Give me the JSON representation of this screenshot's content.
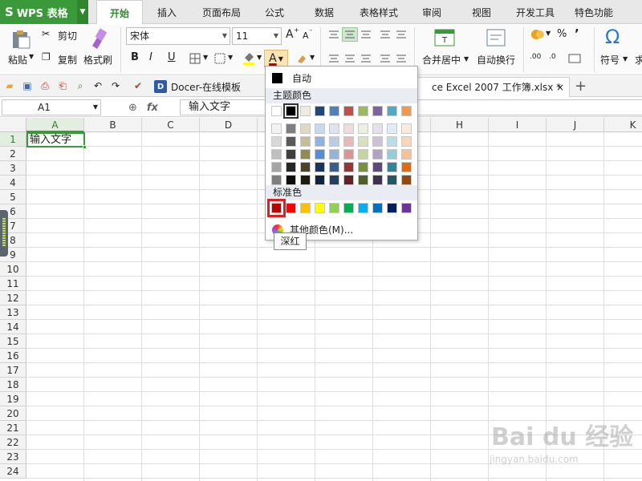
{
  "app": {
    "logo": "S",
    "name": "WPS 表格"
  },
  "menu": {
    "tabs": [
      "开始",
      "插入",
      "页面布局",
      "公式",
      "数据",
      "表格样式",
      "审阅",
      "视图",
      "开发工具",
      "特色功能"
    ],
    "active": 0
  },
  "ribbon": {
    "paste": "粘贴",
    "cut": "剪切",
    "copy": "复制",
    "format_painter": "格式刷",
    "font_name": "宋体",
    "font_size": "11",
    "bold": "B",
    "italic": "I",
    "underline": "U",
    "font_color_letter": "A",
    "merge_center": "合并居中",
    "wrap_text": "自动换行",
    "symbol": "符号",
    "percent": "%",
    "comma": "’",
    "inc_decimal": ".00",
    "dec_decimal": ".0",
    "bigA": "A",
    "smallA": "A",
    "partial_next": "求"
  },
  "quickbar": {
    "docer_tab": "Docer-在线模板",
    "file_tab": "ce Excel 2007 工作簿.xlsx *",
    "close": "×",
    "new_tab": "+"
  },
  "formula": {
    "cell_ref": "A1",
    "fx": "fx",
    "value": "输入文字"
  },
  "grid": {
    "columns": [
      "A",
      "B",
      "C",
      "D",
      "E",
      "F",
      "G",
      "H",
      "I",
      "J",
      "K"
    ],
    "rows": [
      "1",
      "2",
      "3",
      "4",
      "5",
      "6",
      "7",
      "8",
      "9",
      "10",
      "11",
      "12",
      "13",
      "14",
      "15",
      "16",
      "17",
      "18",
      "19",
      "20",
      "21",
      "22",
      "23",
      "24"
    ],
    "active_cell_value": "输入文字"
  },
  "color_popup": {
    "auto_label": "自动",
    "theme_section": "主题颜色",
    "standard_section": "标准色",
    "more_colors": "其他颜色(M)...",
    "theme_top": [
      "#ffffff",
      "#000000",
      "#eeece1",
      "#1f497d",
      "#4f81bd",
      "#c0504d",
      "#9bbb59",
      "#8064a2",
      "#4bacc6",
      "#f79646"
    ],
    "theme_shades": [
      [
        "#f2f2f2",
        "#7f7f7f",
        "#ddd9c3",
        "#c6d9f0",
        "#dbe5f1",
        "#f2dcdb",
        "#ebf1dd",
        "#e5e0ec",
        "#dbeef3",
        "#fdeada"
      ],
      [
        "#d8d8d8",
        "#595959",
        "#c4bd97",
        "#8db3e2",
        "#b8cce4",
        "#e5b9b7",
        "#d7e3bc",
        "#ccc1d9",
        "#b7dde8",
        "#fbd5b5"
      ],
      [
        "#bfbfbf",
        "#3f3f3f",
        "#938953",
        "#548dd4",
        "#95b3d7",
        "#d99694",
        "#c3d69b",
        "#b2a2c7",
        "#92cddc",
        "#fac08f"
      ],
      [
        "#a5a5a5",
        "#262626",
        "#494429",
        "#17365d",
        "#366092",
        "#953734",
        "#76923c",
        "#5f497a",
        "#31859b",
        "#e36c09"
      ],
      [
        "#7f7f7f",
        "#0c0c0c",
        "#1d1b10",
        "#0f243e",
        "#244061",
        "#632423",
        "#4f6128",
        "#3f3151",
        "#205867",
        "#974806"
      ]
    ],
    "standard": [
      "#c00000",
      "#ff0000",
      "#ffc000",
      "#ffff00",
      "#92d050",
      "#00b050",
      "#00b0f0",
      "#0070c0",
      "#002060",
      "#7030a0"
    ],
    "tooltip": "深红"
  },
  "watermark": {
    "main": "Bai du 经验",
    "sub": "jingyan.baidu.com"
  },
  "colors": {
    "accent": "#3a9a3a",
    "highlight": "#e01e1e"
  }
}
